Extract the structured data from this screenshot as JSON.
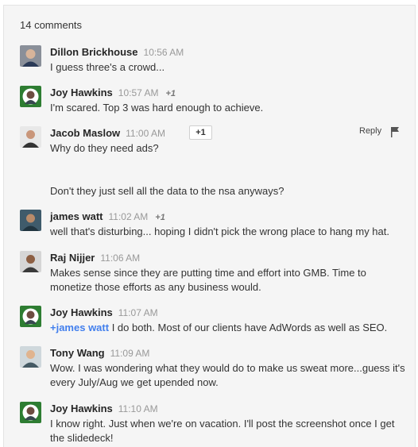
{
  "header": {
    "count_label": "14 comments"
  },
  "actions": {
    "plus_one_button": "+1",
    "reply_label": "Reply"
  },
  "comments": [
    {
      "author": "Dillon Brickhouse",
      "time": "10:56 AM",
      "plus": "",
      "text": "I guess three's a crowd...",
      "avatar_icon": "person-avatar-icon"
    },
    {
      "author": "Joy Hawkins",
      "time": "10:57 AM",
      "plus": "+1",
      "text": "I'm scared. Top 3 was hard enough to achieve.",
      "avatar_icon": "person-avatar-icon"
    },
    {
      "author": "Jacob Maslow",
      "time": "11:00 AM",
      "plus": "",
      "text": "Why do they need ads?",
      "text2": "Don't they just sell all the data to the nsa anyways?",
      "avatar_icon": "person-avatar-icon"
    },
    {
      "author": "james watt",
      "time": "11:02 AM",
      "plus": "+1",
      "text": "well that's disturbing... hoping I didn't pick the wrong place to hang my hat.",
      "avatar_icon": "person-avatar-icon"
    },
    {
      "author": "Raj Nijjer",
      "time": "11:06 AM",
      "plus": "",
      "text": "Makes sense since they are putting time and effort into GMB. Time to monetize those efforts as any business would.",
      "avatar_icon": "person-avatar-icon"
    },
    {
      "author": "Joy Hawkins",
      "time": "11:07 AM",
      "plus": "",
      "mention": "+james watt",
      "text": " I do both. Most of our clients have AdWords as well as SEO.",
      "avatar_icon": "person-avatar-icon"
    },
    {
      "author": "Tony Wang",
      "time": "11:09 AM",
      "plus": "",
      "text": "Wow. I was wondering what they would do to make us sweat more...guess it's every July/Aug we get upended now.",
      "avatar_icon": "person-avatar-icon"
    },
    {
      "author": "Joy Hawkins",
      "time": "11:10 AM",
      "plus": "",
      "text": "I know right. Just when we're on vacation. I'll post the screenshot once I get the slidedeck!",
      "avatar_icon": "person-avatar-icon"
    }
  ],
  "colors": {
    "background": "#f5f5f5",
    "mention": "#427fed",
    "joy_badge": "#2e7d32"
  }
}
